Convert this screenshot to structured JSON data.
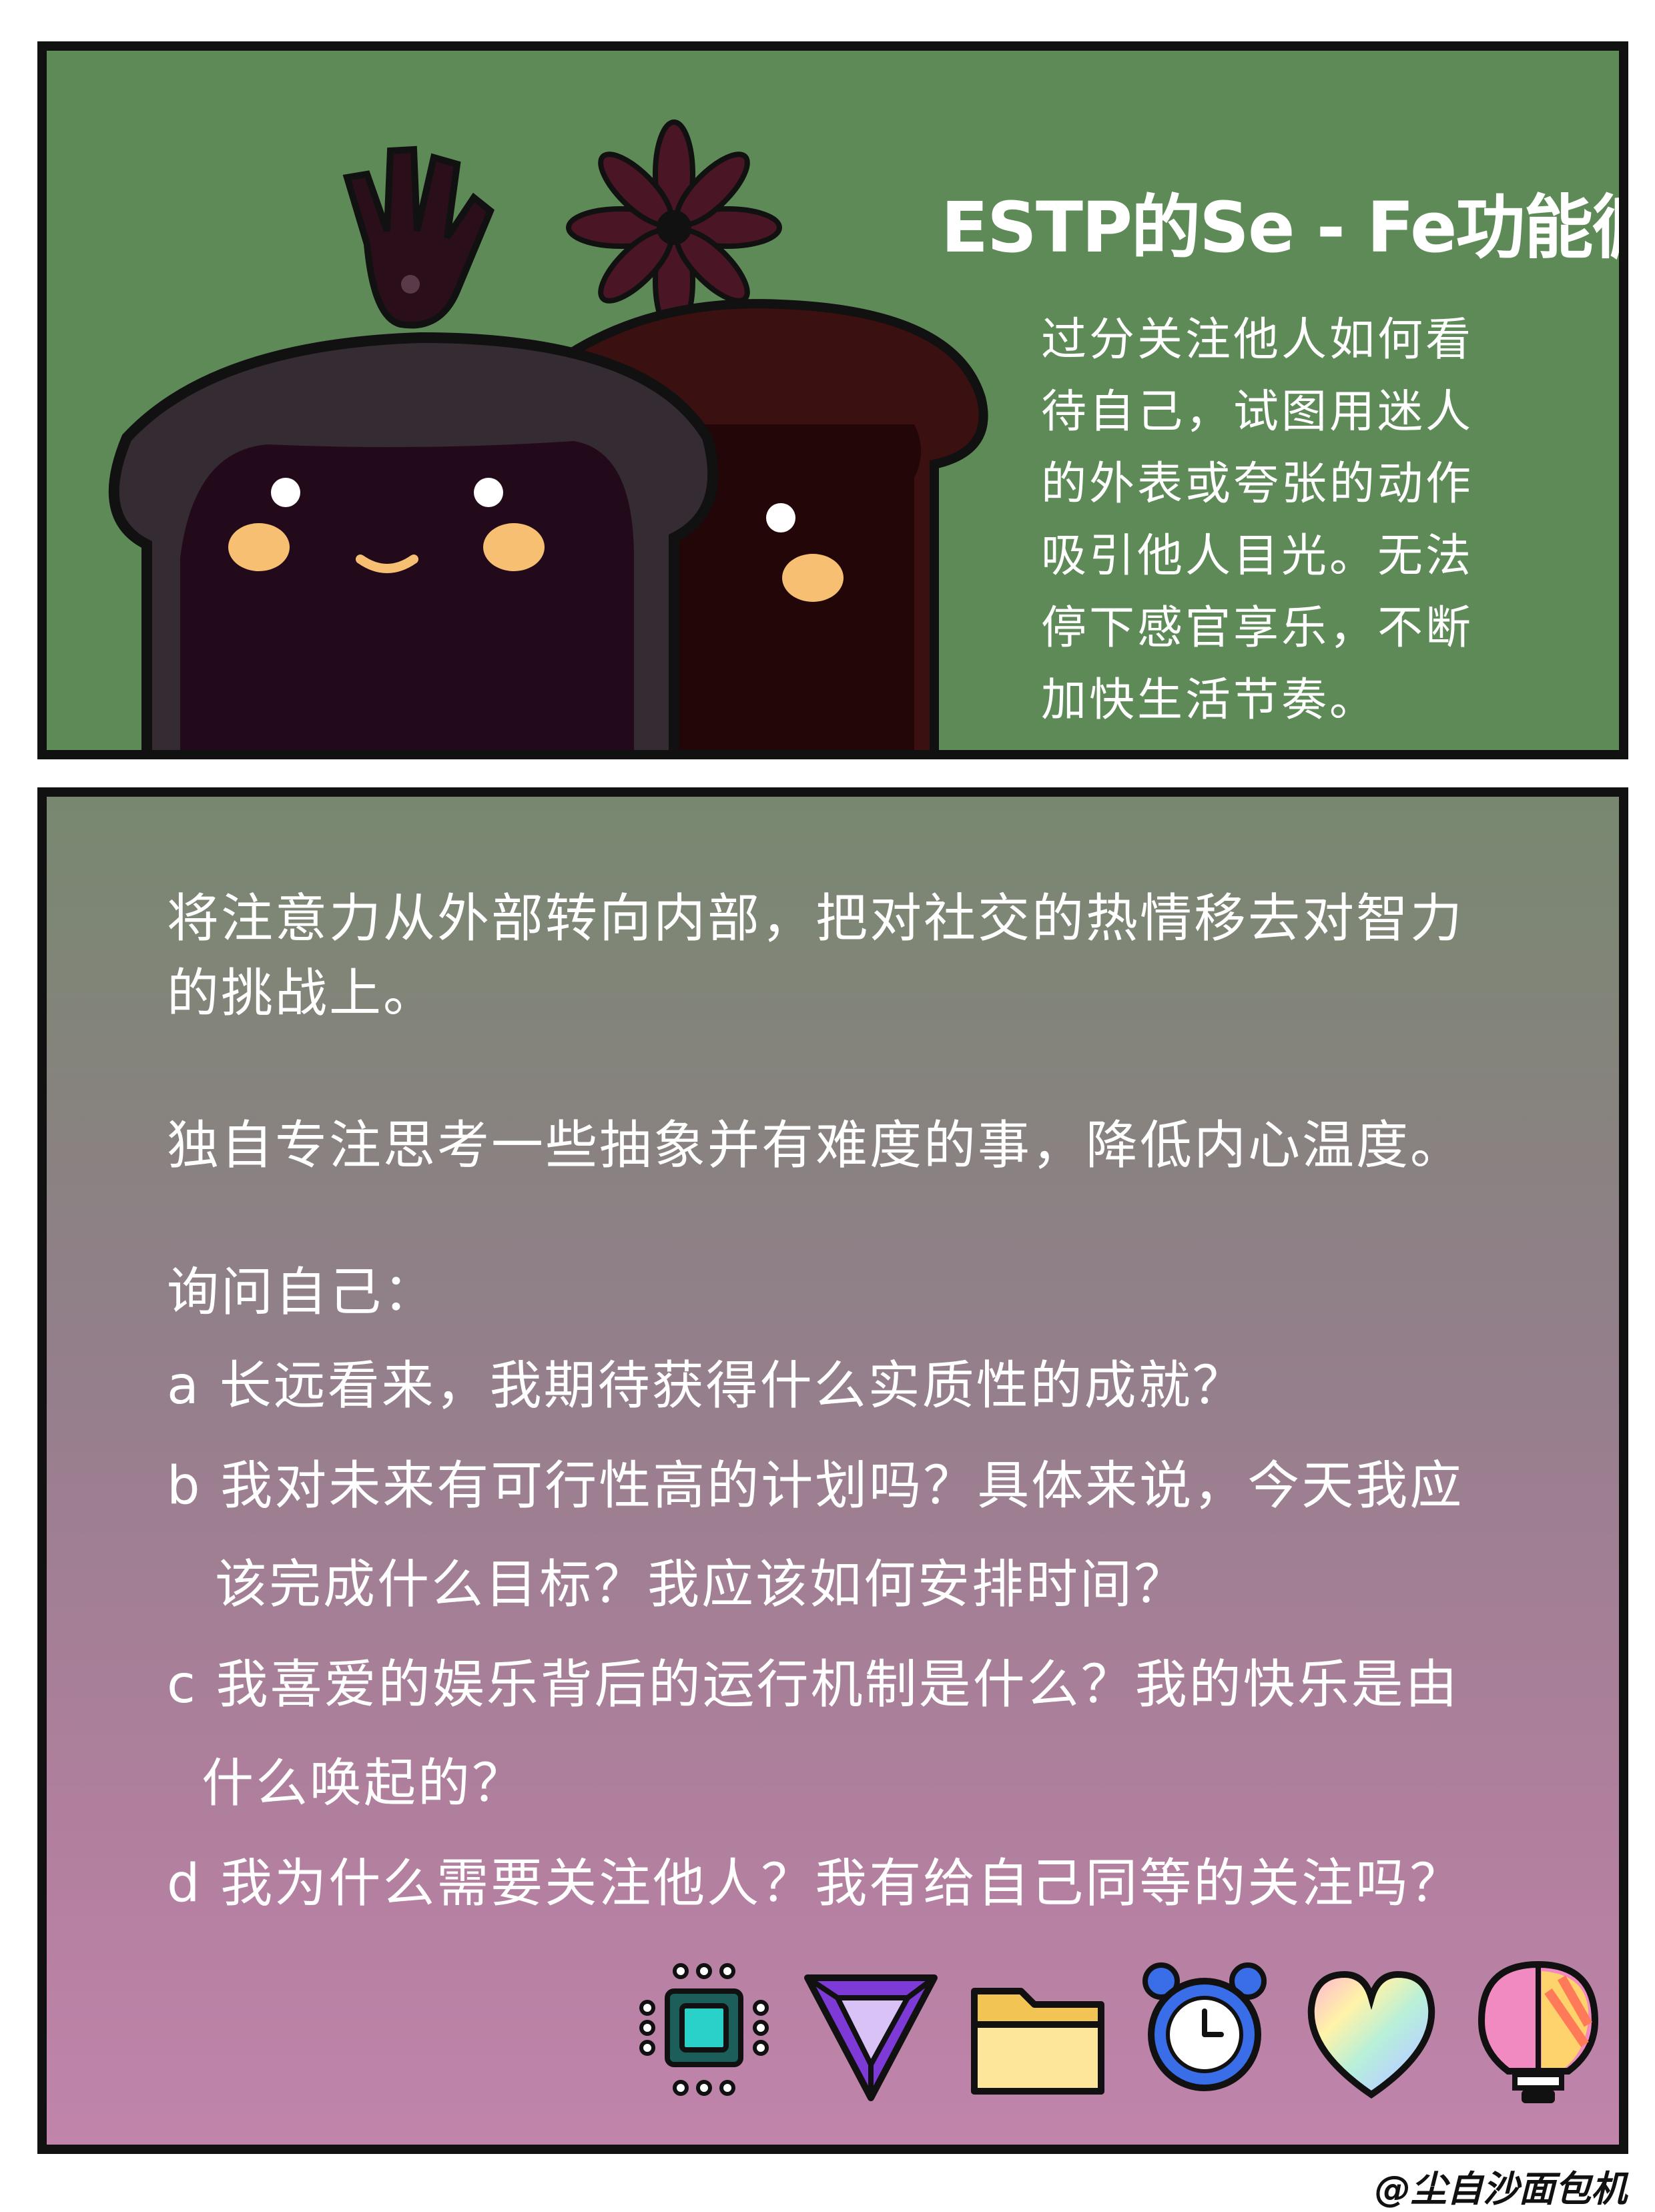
{
  "top_panel": {
    "title": "ESTP的Se - Fe功能循环",
    "description_lines": [
      "过分关注他人如何看",
      "待自己，试图用迷人",
      "的外表或夸张的动作",
      "吸引他人目光。无法",
      "停下感官享乐，不断",
      "加快生活节奏。"
    ]
  },
  "bottom_panel": {
    "intro_lines": [
      "将注意力从外部转向内部，把对社交的热情移去对智力",
      "的挑战上。"
    ],
    "reflect_line": "独自专注思考一些抽象并有难度的事，降低内心温度。",
    "ask_heading": "询问自己：",
    "questions": [
      {
        "lines": [
          "a 长远看来，我期待获得什么实质性的成就？"
        ]
      },
      {
        "lines": [
          "b 我对未来有可行性高的计划吗？具体来说，今天我应",
          "该完成什么目标？我应该如何安排时间？"
        ]
      },
      {
        "lines": [
          "c 我喜爱的娱乐背后的运行机制是什么？我的快乐是由",
          "什么唤起的？"
        ]
      },
      {
        "lines": [
          "d 我为什么需要关注他人？我有给自己同等的关注吗？"
        ]
      }
    ],
    "icons": [
      "chip-icon",
      "impossible-triangle-icon",
      "folder-icon",
      "alarm-clock-icon",
      "rainbow-heart-icon",
      "brain-lightbulb-icon"
    ]
  },
  "signature": "@尘自沙面包机",
  "colors": {
    "top_panel_bg": "#5e8a58",
    "bottom_gradient_top": "#78886f",
    "bottom_gradient_bottom": "#c184ab",
    "text": "#ffffff",
    "border": "#111111"
  }
}
